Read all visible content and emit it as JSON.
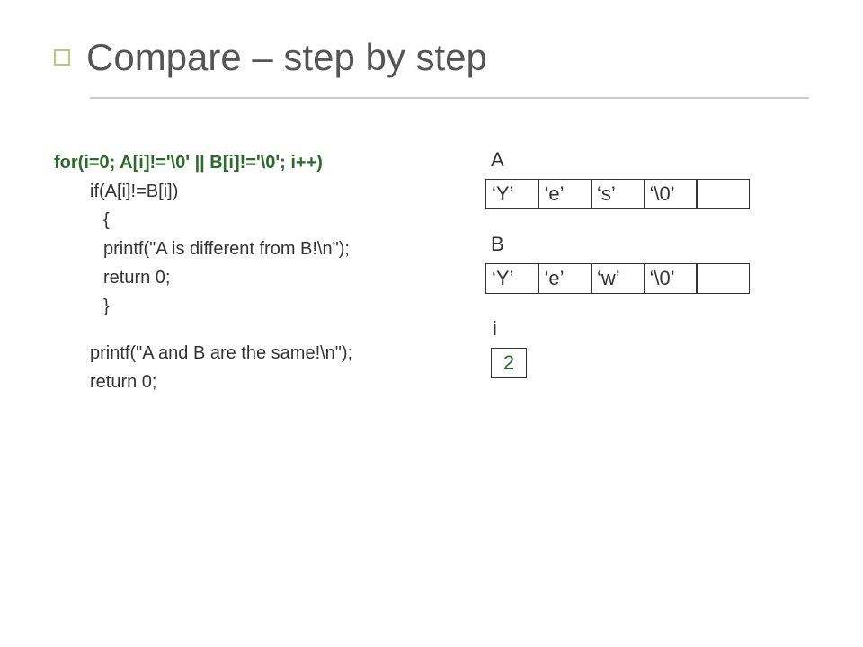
{
  "title": "Compare – step by step",
  "code": {
    "l0": "for(i=0; A[i]!='\\0' || B[i]!='\\0'; i++)",
    "l1": "if(A[i]!=B[i])",
    "l2": "{",
    "l3": "printf(\"A is different from B!\\n\");",
    "l4": "return 0;",
    "l5": "}",
    "l6": "printf(\"A and B are the same!\\n\");",
    "l7": "return 0;"
  },
  "labels": {
    "A": "A",
    "B": "B",
    "i": "i"
  },
  "arrays": {
    "A": [
      "‘Y’",
      "‘e’",
      "‘s’",
      "‘\\0’",
      ""
    ],
    "B": [
      "‘Y’",
      "‘e’",
      "‘w’",
      "‘\\0’",
      ""
    ]
  },
  "i_value": "2"
}
